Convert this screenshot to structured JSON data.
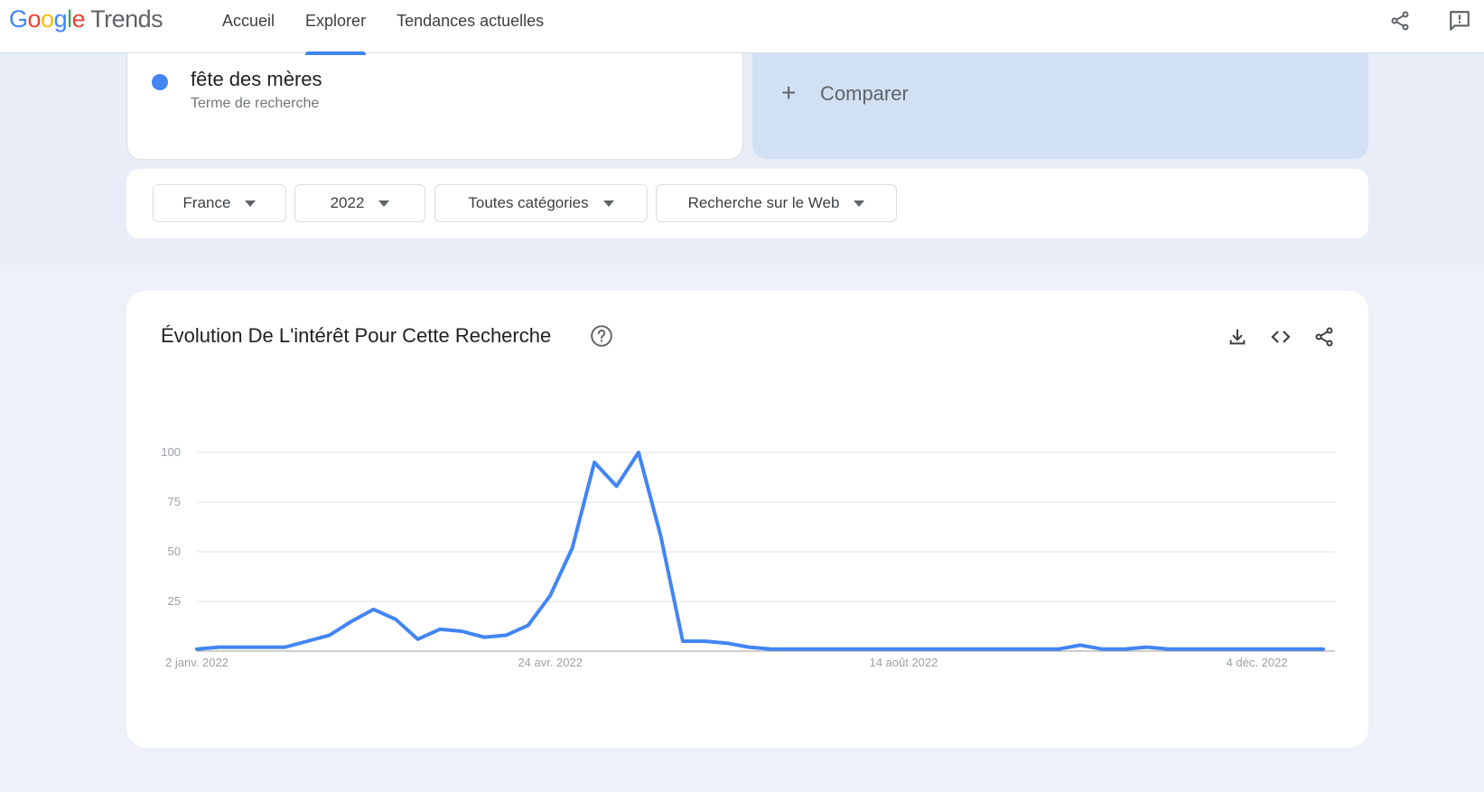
{
  "header": {
    "logo": {
      "google": [
        "G",
        "o",
        "o",
        "g",
        "l",
        "e"
      ],
      "product": "Trends"
    },
    "nav": [
      {
        "label": "Accueil",
        "active": false
      },
      {
        "label": "Explorer",
        "active": true
      },
      {
        "label": "Tendances actuelles",
        "active": false
      }
    ],
    "icons": [
      "share-icon",
      "feedback-icon"
    ]
  },
  "search_term": {
    "name": "fête des mères",
    "type": "Terme de recherche",
    "color": "#4285f4"
  },
  "compare": {
    "label": "Comparer",
    "icon": "plus-icon"
  },
  "filters": [
    {
      "label": "France"
    },
    {
      "label": "2022"
    },
    {
      "label": "Toutes catégories"
    },
    {
      "label": "Recherche sur le Web"
    }
  ],
  "chart_card": {
    "title": "Évolution De L'intérêt Pour Cette Recherche",
    "actions": [
      "download-icon",
      "embed-code-icon",
      "share-icon"
    ]
  },
  "chart_data": {
    "type": "line",
    "title": "Évolution De L'intérêt Pour Cette Recherche",
    "xlabel": "",
    "ylabel": "",
    "ylim": [
      0,
      100
    ],
    "yticks": [
      25,
      50,
      75,
      100
    ],
    "xtick_labels": [
      {
        "label": "2 janv. 2022",
        "index": 0
      },
      {
        "label": "24 avr. 2022",
        "index": 16
      },
      {
        "label": "14 août 2022",
        "index": 32
      },
      {
        "label": "4 déc. 2022",
        "index": 48
      }
    ],
    "grid": true,
    "legend": "none",
    "series": [
      {
        "name": "fête des mères",
        "color": "#4285f4",
        "x_start": "2 janv. 2022",
        "x_step": "1 week",
        "values": [
          1,
          2,
          2,
          2,
          2,
          5,
          8,
          15,
          21,
          16,
          6,
          11,
          10,
          7,
          8,
          13,
          28,
          52,
          95,
          83,
          100,
          58,
          5,
          5,
          4,
          2,
          1,
          1,
          1,
          1,
          1,
          1,
          1,
          1,
          1,
          1,
          1,
          1,
          1,
          1,
          3,
          1,
          1,
          2,
          1,
          1,
          1,
          1,
          1,
          1,
          1,
          1
        ]
      }
    ]
  }
}
